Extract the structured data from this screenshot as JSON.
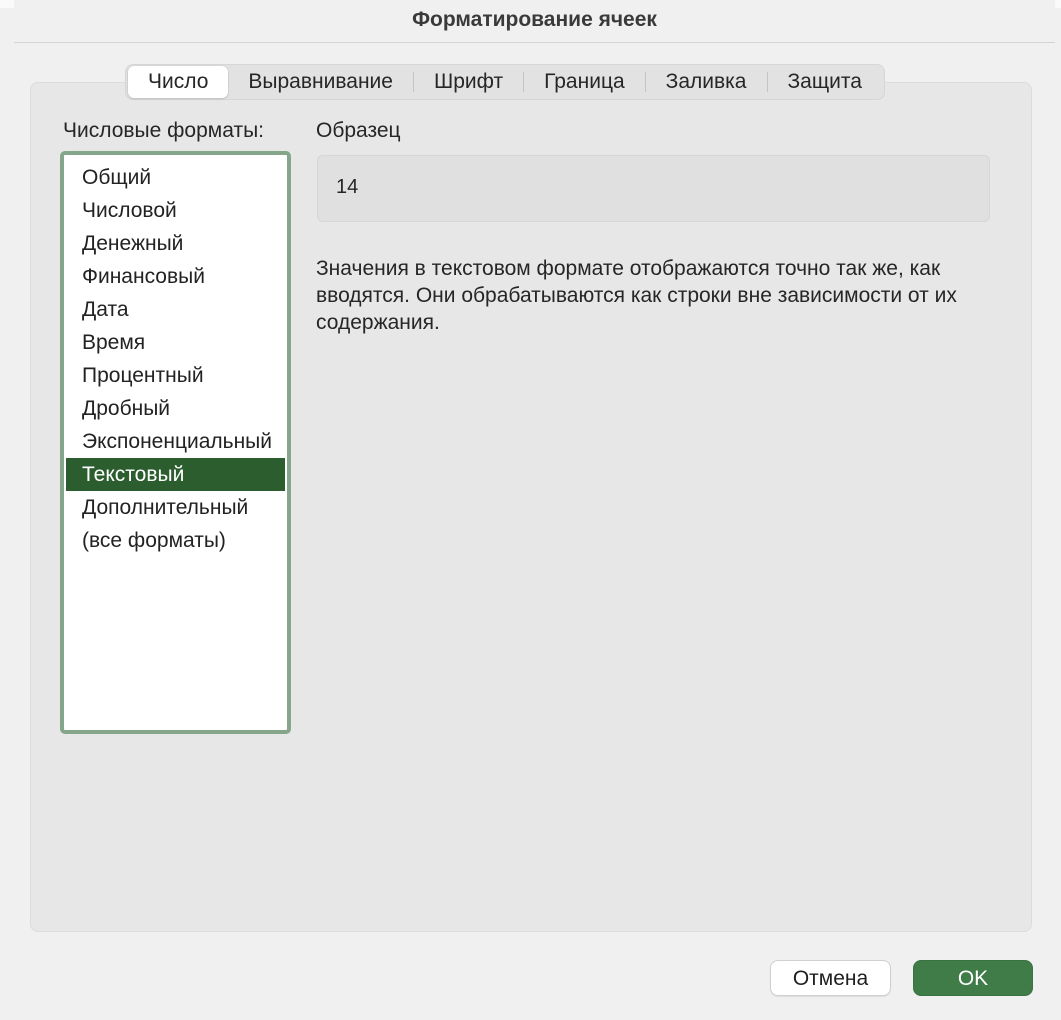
{
  "dialog": {
    "title": "Форматирование ячеек"
  },
  "tabs": [
    {
      "label": "Число",
      "active": true
    },
    {
      "label": "Выравнивание",
      "active": false
    },
    {
      "label": "Шрифт",
      "active": false
    },
    {
      "label": "Граница",
      "active": false
    },
    {
      "label": "Заливка",
      "active": false
    },
    {
      "label": "Защита",
      "active": false
    }
  ],
  "formats": {
    "label": "Числовые форматы:",
    "items": [
      "Общий",
      "Числовой",
      "Денежный",
      "Финансовый",
      "Дата",
      "Время",
      "Процентный",
      "Дробный",
      "Экспоненциальный",
      "Текстовый",
      "Дополнительный",
      "(все форматы)"
    ],
    "selected": "Текстовый"
  },
  "sample": {
    "label": "Образец",
    "value": "14"
  },
  "description": "Значения в текстовом формате отображаются точно так же, как вводятся. Они обрабатываются как строки вне зависимости от их содержания.",
  "buttons": {
    "cancel": "Отмена",
    "ok": "OK"
  },
  "colors": {
    "accent": "#3f7c47",
    "selection": "#2b5d2e",
    "list_border": "#85a68a"
  }
}
